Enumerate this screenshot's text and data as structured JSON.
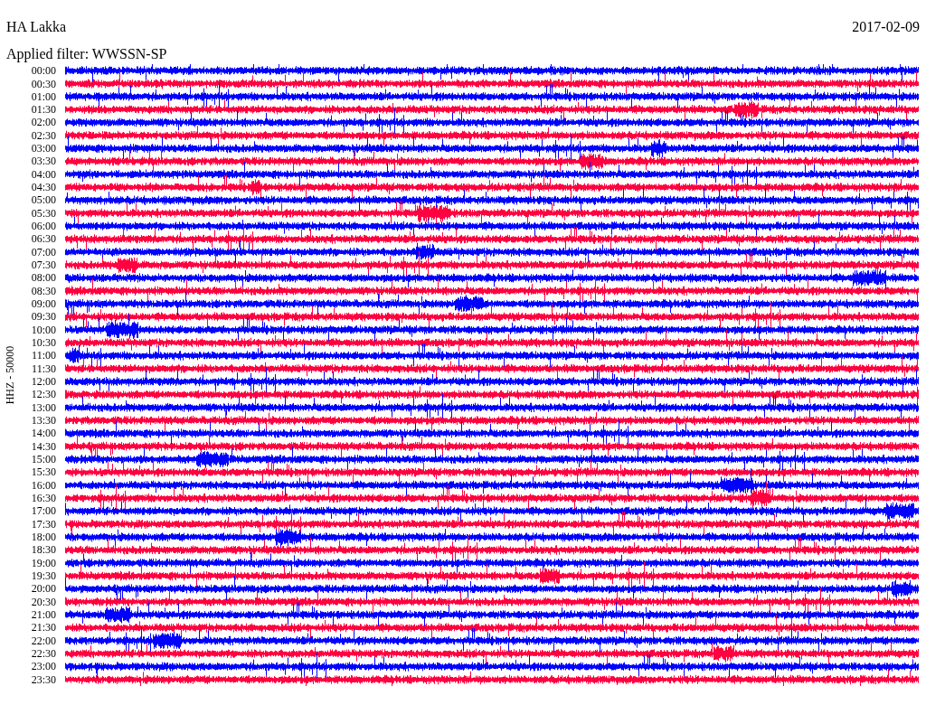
{
  "station": "HA Lakka",
  "date": "2017-02-09",
  "filter_label": "Applied filter: WWSSN-SP",
  "axis_label": "HHZ - 50000",
  "rows": [
    {
      "time": "00:00",
      "color": "#0000ff"
    },
    {
      "time": "00:30",
      "color": "#ff0040"
    },
    {
      "time": "01:00",
      "color": "#0000ff"
    },
    {
      "time": "01:30",
      "color": "#ff0040"
    },
    {
      "time": "02:00",
      "color": "#0000ff"
    },
    {
      "time": "02:30",
      "color": "#ff0040"
    },
    {
      "time": "03:00",
      "color": "#0000ff"
    },
    {
      "time": "03:30",
      "color": "#ff0040"
    },
    {
      "time": "04:00",
      "color": "#0000ff"
    },
    {
      "time": "04:30",
      "color": "#ff0040"
    },
    {
      "time": "05:00",
      "color": "#0000ff"
    },
    {
      "time": "05:30",
      "color": "#ff0040"
    },
    {
      "time": "06:00",
      "color": "#0000ff"
    },
    {
      "time": "06:30",
      "color": "#ff0040"
    },
    {
      "time": "07:00",
      "color": "#0000ff"
    },
    {
      "time": "07:30",
      "color": "#ff0040"
    },
    {
      "time": "08:00",
      "color": "#0000ff"
    },
    {
      "time": "08:30",
      "color": "#ff0040"
    },
    {
      "time": "09:00",
      "color": "#0000ff"
    },
    {
      "time": "09:30",
      "color": "#ff0040"
    },
    {
      "time": "10:00",
      "color": "#0000ff"
    },
    {
      "time": "10:30",
      "color": "#ff0040"
    },
    {
      "time": "11:00",
      "color": "#0000ff"
    },
    {
      "time": "11:30",
      "color": "#ff0040"
    },
    {
      "time": "12:00",
      "color": "#0000ff"
    },
    {
      "time": "12:30",
      "color": "#ff0040"
    },
    {
      "time": "13:00",
      "color": "#0000ff"
    },
    {
      "time": "13:30",
      "color": "#ff0040"
    },
    {
      "time": "14:00",
      "color": "#0000ff"
    },
    {
      "time": "14:30",
      "color": "#ff0040"
    },
    {
      "time": "15:00",
      "color": "#0000ff"
    },
    {
      "time": "15:30",
      "color": "#ff0040"
    },
    {
      "time": "16:00",
      "color": "#0000ff"
    },
    {
      "time": "16:30",
      "color": "#ff0040"
    },
    {
      "time": "17:00",
      "color": "#0000ff"
    },
    {
      "time": "17:30",
      "color": "#ff0040"
    },
    {
      "time": "18:00",
      "color": "#0000ff"
    },
    {
      "time": "18:30",
      "color": "#ff0040"
    },
    {
      "time": "19:00",
      "color": "#0000ff"
    },
    {
      "time": "19:30",
      "color": "#ff0040"
    },
    {
      "time": "20:00",
      "color": "#0000ff"
    },
    {
      "time": "20:30",
      "color": "#ff0040"
    },
    {
      "time": "21:00",
      "color": "#0000ff"
    },
    {
      "time": "21:30",
      "color": "#ff0040"
    },
    {
      "time": "22:00",
      "color": "#0000ff"
    },
    {
      "time": "22:30",
      "color": "#ff0040"
    },
    {
      "time": "23:00",
      "color": "#0000ff"
    },
    {
      "time": "23:30",
      "color": "#ff0040"
    }
  ]
}
